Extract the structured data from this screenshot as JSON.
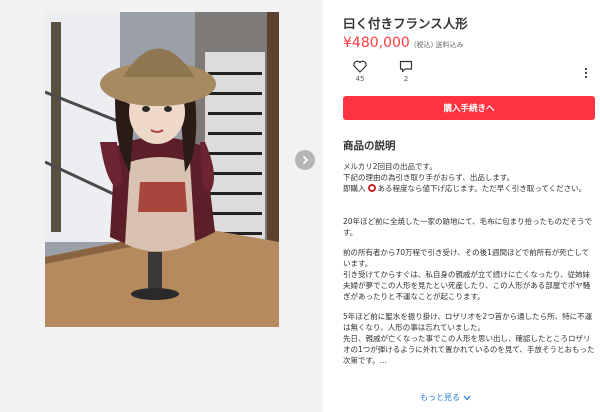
{
  "item": {
    "title": "曰く付きフランス人形",
    "price": "¥480,000",
    "price_note": "(税込) 送料込み"
  },
  "actions": {
    "like_count": "45",
    "comment_count": "2"
  },
  "buy_button": "購入手続きへ",
  "description": {
    "section_title": "商品の説明",
    "p1_l1": "メルカリ2回目の出品です。",
    "p1_l2": "下記の理由の為引き取り手がおらず、出品します。",
    "p1_l3a": "即購入",
    "p1_l3b": "ある程度なら値下げ応じます。ただ早く引き取ってください。",
    "p2": "20年ほど前に全焼した一家の跡地にて、毛布に包まり拾ったものだそうです。",
    "p3_l1": "前の所有者から70万程で引き受け、その後1週間ほどで前所有が死亡しています。",
    "p3_l2": "引き受けてからすぐは、私自身の親戚が立て続けに亡くなったり、従姉妹夫婦が夢でこの人形を見たとい死産したり、この人形がある部屋でポヤ騒ぎがあったりと不運なことが起こります。",
    "p4_l1": "5年ほど前に聖水を振り掛け、ロザリオを2つ首から通したら所、特に不運は無くなり、人形の事は忘れていました。",
    "p4_l2": "先日、親戚が亡くなった事でこの人形を思い出し、確認したところロザリオの1つが弾けるように外れて置かれているのを見て、手放そうとおもった次第です。..."
  },
  "show_more": "もっと見る",
  "icons": {
    "like": "heart-icon",
    "comment": "comment-icon",
    "more": "more-vertical-icon",
    "next": "chevron-right-icon",
    "badge": "circle-badge-icon",
    "show_more_chevron": "chevron-down-icon"
  },
  "colors": {
    "accent": "#ff333f",
    "price": "#ff3b3b",
    "link": "#1e7fd6"
  }
}
